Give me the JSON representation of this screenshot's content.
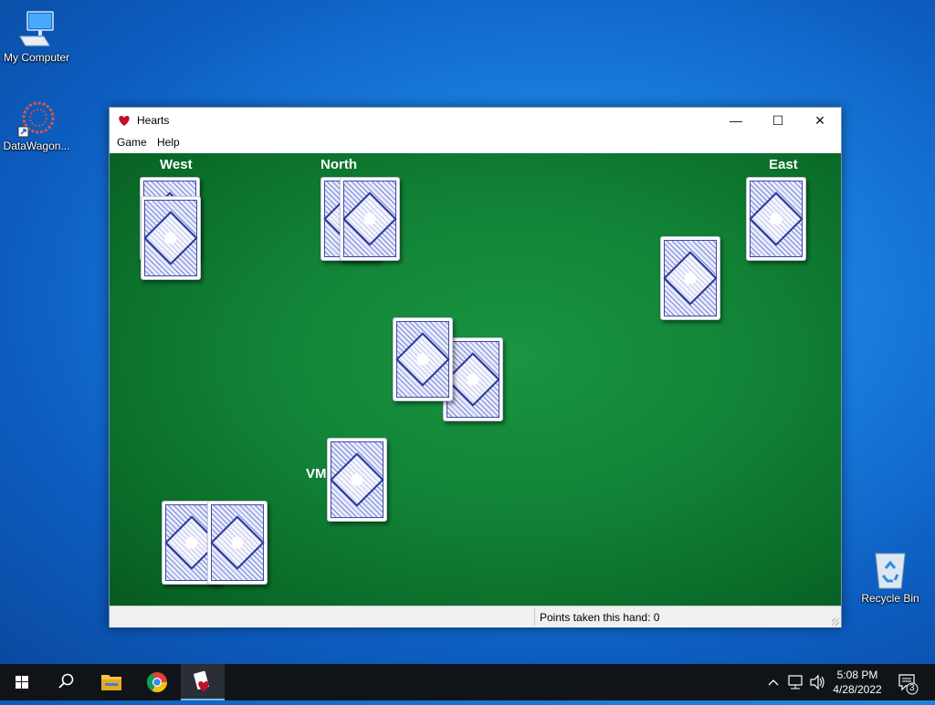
{
  "desktop": {
    "icons": [
      {
        "label": "My Computer",
        "icon": "computer-icon"
      },
      {
        "label": "DataWagon...",
        "icon": "datawagon-icon"
      },
      {
        "label": "Recycle Bin",
        "icon": "recycle-bin-icon"
      }
    ]
  },
  "window": {
    "title": "Hearts",
    "icon": "hearts-app-icon",
    "controls": {
      "minimize": "—",
      "maximize": "☐",
      "close": "✕"
    },
    "menu": [
      "Game",
      "Help"
    ],
    "players": {
      "west": "West",
      "north": "North",
      "east": "East",
      "south": "VM"
    },
    "status": "Points taken this hand: 0"
  },
  "taskbar": {
    "apps": [
      "start-icon",
      "search-icon",
      "file-explorer-icon",
      "chrome-icon",
      "hearts-app-icon"
    ],
    "clock": {
      "time": "5:08 PM",
      "date": "4/28/2022"
    },
    "notification_count": "3",
    "colors": {
      "accent": "#76b9ed",
      "bar": "#101418"
    }
  }
}
